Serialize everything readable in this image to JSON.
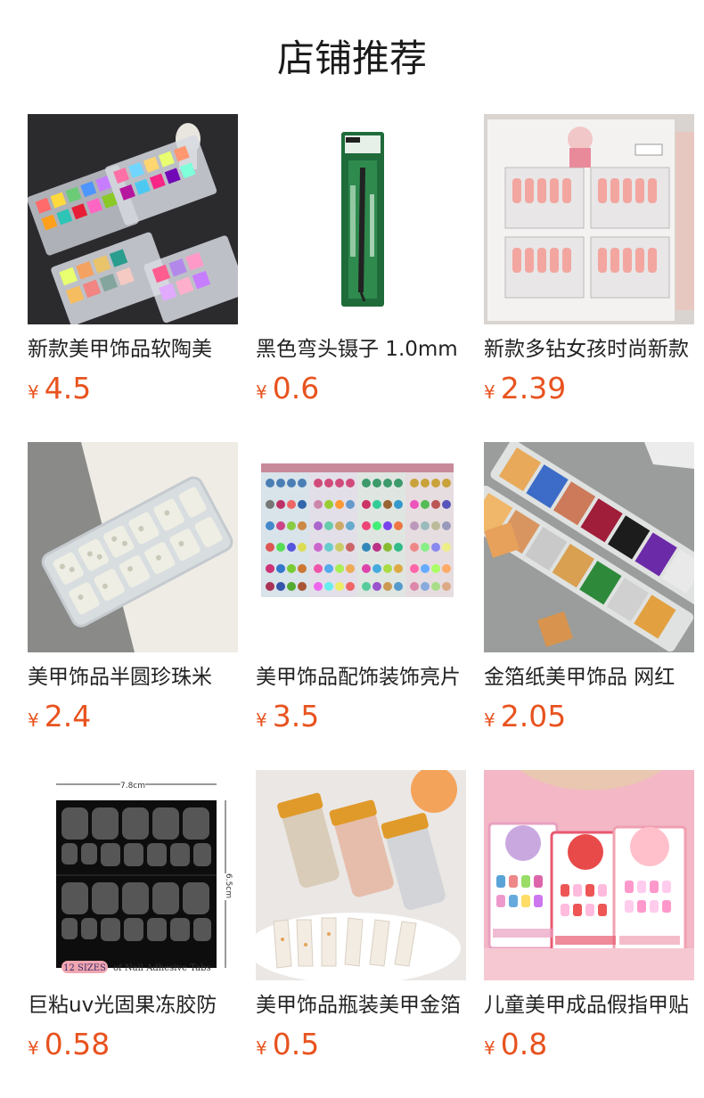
{
  "header": {
    "title": "店铺推荐"
  },
  "currency": "¥",
  "products": [
    {
      "name": "新款美甲饰品软陶美",
      "price": "4.5",
      "image": "nail-deco-boxes-colorful"
    },
    {
      "name": "黑色弯头镊子 1.0mm",
      "price": "0.6",
      "image": "tweezers-package"
    },
    {
      "name": "新款多钻女孩时尚新款",
      "price": "2.39",
      "image": "press-on-nails-box"
    },
    {
      "name": "美甲饰品半圆珍珠米",
      "price": "2.4",
      "image": "pearl-box"
    },
    {
      "name": "美甲饰品配饰装饰亮片",
      "price": "3.5",
      "image": "glitter-sets"
    },
    {
      "name": "金箔纸美甲饰品 网红",
      "price": "2.05",
      "image": "gold-foil-box"
    },
    {
      "name": "巨粘uv光固果冻胶防",
      "price": "0.58",
      "image": "adhesive-tabs-sheet",
      "image_text": {
        "width_label": "7.8cm",
        "height_label": "6.5cm",
        "sizes_badge": "12 SIZES",
        "caption": "of Nail Adhesive Tabs"
      }
    },
    {
      "name": "美甲饰品瓶装美甲金箔",
      "price": "0.5",
      "image": "foil-jars"
    },
    {
      "name": "儿童美甲成品假指甲贴",
      "price": "0.8",
      "image": "kids-nail-cards"
    }
  ]
}
